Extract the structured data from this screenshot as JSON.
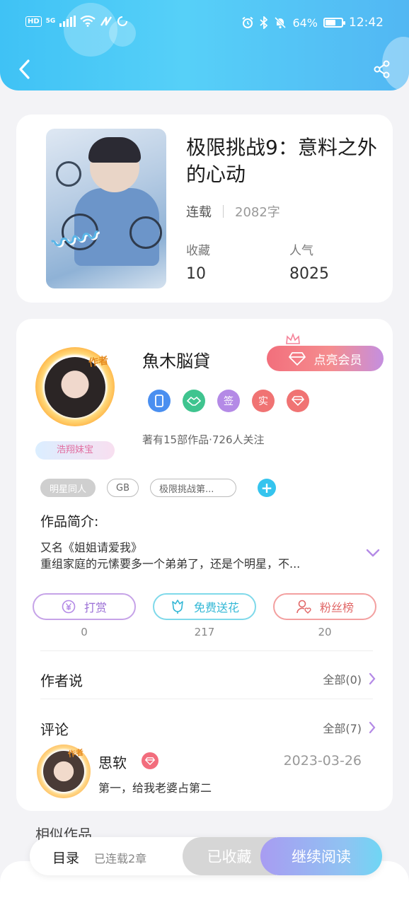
{
  "status_bar": {
    "hd": "HD",
    "network": "5G",
    "battery_text": "64%",
    "battery_level": 0.64,
    "time": "12:42",
    "icons": [
      "signal-icon",
      "wifi-icon",
      "nfc-icon",
      "sync-icon",
      "alarm-icon",
      "bluetooth-icon",
      "mute-icon",
      "battery-icon"
    ]
  },
  "header": {
    "back_icon": "chevron-left-icon",
    "share_icon": "share-icon"
  },
  "book": {
    "title": "极限挑战9：意料之外的心动",
    "status": "连载",
    "words": "2082字",
    "favorites_label": "收藏",
    "favorites": "10",
    "popularity_label": "人气",
    "popularity": "8025"
  },
  "author": {
    "name": "魚木脳貸",
    "avatar_tag": "作者",
    "fan_badge": "浩翔妹宝",
    "vip_button": "点亮会员",
    "badges": [
      {
        "icon": "phone-icon",
        "text": "",
        "color": "#4a8ff0"
      },
      {
        "icon": "handshake-icon",
        "text": "",
        "color": "#3fc48f"
      },
      {
        "icon": "sign-badge-icon",
        "text": "签",
        "color": "#b48ae6"
      },
      {
        "icon": "real-name-badge-icon",
        "text": "实",
        "color": "#f07373"
      },
      {
        "icon": "diamond-icon",
        "text": "",
        "color": "#f07373"
      }
    ],
    "works_info": "著有15部作品·726人关注"
  },
  "tags": [
    "明星同人",
    "GB",
    "极限挑战第..."
  ],
  "intro": {
    "heading": "作品简介:",
    "line1": "又名《姐姐请爱我》",
    "line2": "重组家庭的元愫要多一个弟弟了，还是个明星，不..."
  },
  "actions": [
    {
      "label": "打赏",
      "count": "0",
      "icon": "yen-icon"
    },
    {
      "label": "免费送花",
      "count": "217",
      "icon": "flower-icon"
    },
    {
      "label": "粉丝榜",
      "count": "20",
      "icon": "user-heart-icon"
    }
  ],
  "author_says": {
    "heading": "作者说",
    "more": "全部(0)"
  },
  "comments": {
    "heading": "评论",
    "more": "全部(7)",
    "first": {
      "avatar_tag": "作者",
      "name": "思软",
      "date": "2023-03-26",
      "text": "第一，给我老婆占第二"
    }
  },
  "similar_heading": "相似作品",
  "bottom_bar": {
    "toc": "目录",
    "chapters": "已连载2章",
    "collected": "已收藏",
    "continue": "继续阅读"
  },
  "colors": {
    "header_start": "#3fc2f5",
    "header_end": "#52b7f3",
    "vip_start": "#f26f7c",
    "read_start": "#a89cf2",
    "read_end": "#6fd6f4"
  }
}
